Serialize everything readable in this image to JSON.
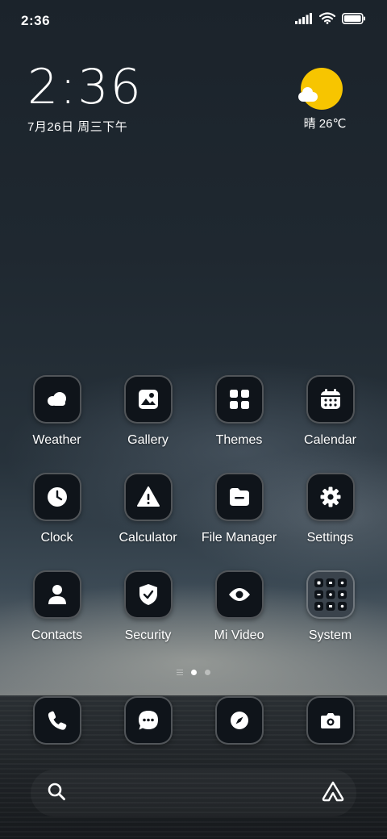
{
  "status_bar": {
    "time": "2:36",
    "icons": [
      "signal-icon",
      "wifi-icon",
      "battery-icon"
    ]
  },
  "clock_widget": {
    "time": "2:36",
    "date": "7月26日 周三下午"
  },
  "weather_widget": {
    "icon": "sun-cloud-icon",
    "text": "晴 26℃"
  },
  "apps": [
    {
      "label": "Weather",
      "icon": "weather-icon"
    },
    {
      "label": "Gallery",
      "icon": "gallery-icon"
    },
    {
      "label": "Themes",
      "icon": "themes-icon"
    },
    {
      "label": "Calendar",
      "icon": "calendar-icon"
    },
    {
      "label": "Clock",
      "icon": "clock-icon"
    },
    {
      "label": "Calculator",
      "icon": "calculator-icon"
    },
    {
      "label": "File Manager",
      "icon": "file-manager-icon"
    },
    {
      "label": "Settings",
      "icon": "settings-icon"
    },
    {
      "label": "Contacts",
      "icon": "contacts-icon"
    },
    {
      "label": "Security",
      "icon": "security-icon"
    },
    {
      "label": "Mi Video",
      "icon": "eye-icon"
    },
    {
      "label": "System",
      "icon": "folder-icon"
    }
  ],
  "page_indicator": {
    "pages": 3,
    "active": 1
  },
  "dock": [
    {
      "icon": "phone-icon"
    },
    {
      "icon": "messages-icon"
    },
    {
      "icon": "browser-icon"
    },
    {
      "icon": "camera-icon"
    }
  ],
  "search_bar": {
    "left_icon": "search-icon",
    "right_icon": "assistant-icon"
  },
  "colors": {
    "icon_bg": "#0f141a",
    "sun": "#f7c500",
    "text": "#ffffff"
  }
}
